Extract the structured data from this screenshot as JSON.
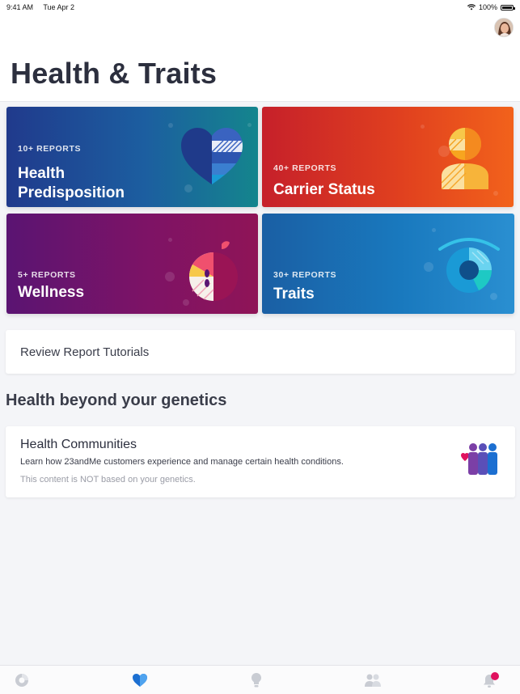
{
  "status_bar": {
    "time": "9:41 AM",
    "date": "Tue  Apr 2",
    "battery": "100%"
  },
  "header": {
    "title": "Health & Traits"
  },
  "tiles": [
    {
      "count": "10+ REPORTS",
      "name_line1": "Health",
      "name_line2": "Predisposition"
    },
    {
      "count": "40+ REPORTS",
      "name": "Carrier Status"
    },
    {
      "count": "5+ REPORTS",
      "name": "Wellness"
    },
    {
      "count": "30+ REPORTS",
      "name": "Traits"
    }
  ],
  "tutorials": {
    "label": "Review Report Tutorials"
  },
  "section": {
    "title": "Health beyond your genetics"
  },
  "community": {
    "title": "Health Communities",
    "description": "Learn how 23andMe customers experience and manage certain health conditions.",
    "note": "This content is NOT based on your genetics."
  },
  "tabbar": {
    "icons": [
      "dashboard-icon",
      "heart-icon",
      "lightbulb-icon",
      "people-icon",
      "bell-icon"
    ],
    "active_color": "#1c6fd1",
    "badge_color": "#e0125f"
  },
  "colors": {
    "health": "#1c5ea0",
    "carrier": "#e0401f",
    "wellness": "#7d1366",
    "traits": "#1979be"
  }
}
